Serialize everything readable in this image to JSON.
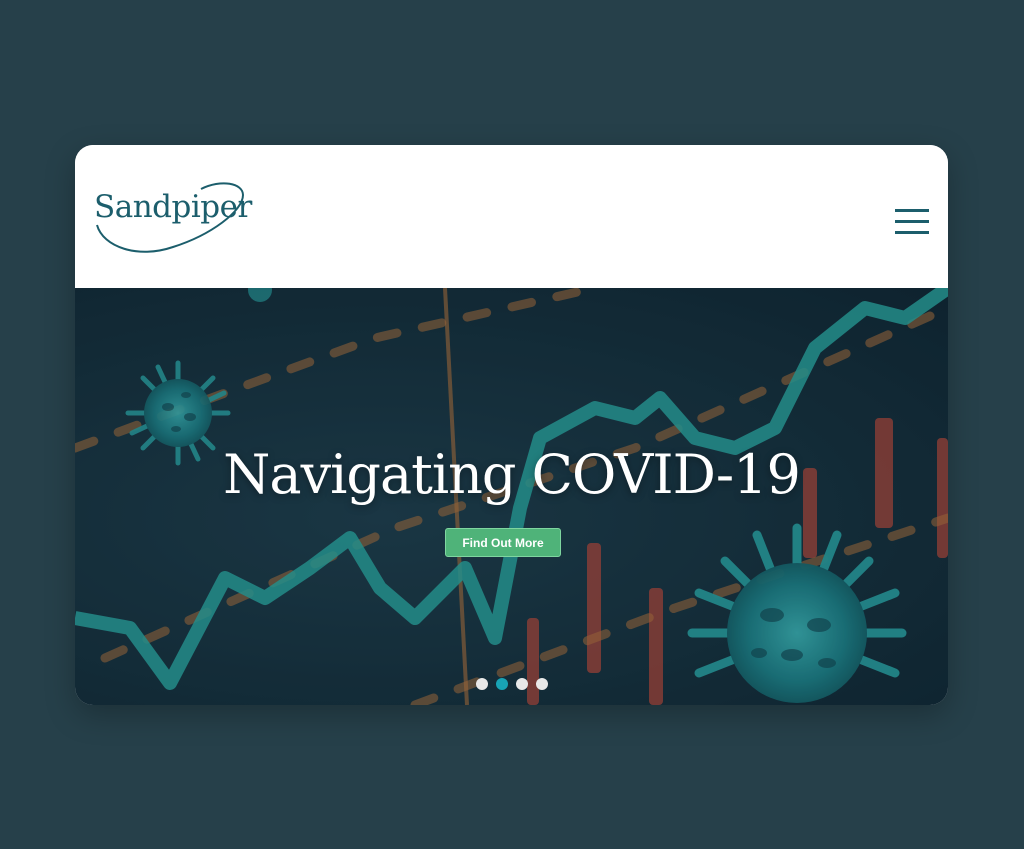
{
  "brand": {
    "name": "Sandpiper",
    "color": "#1c5e6c"
  },
  "header": {
    "menu_icon": "hamburger-menu-icon"
  },
  "hero": {
    "title": "Navigating COVID-19",
    "cta_label": "Find Out More",
    "cta_color": "#4fb379",
    "background": "dark stock-chart with virus illustrations",
    "slides": {
      "count": 4,
      "active": 2
    },
    "active_dot_color": "#18a3b5"
  },
  "page": {
    "background": "#26404a"
  }
}
